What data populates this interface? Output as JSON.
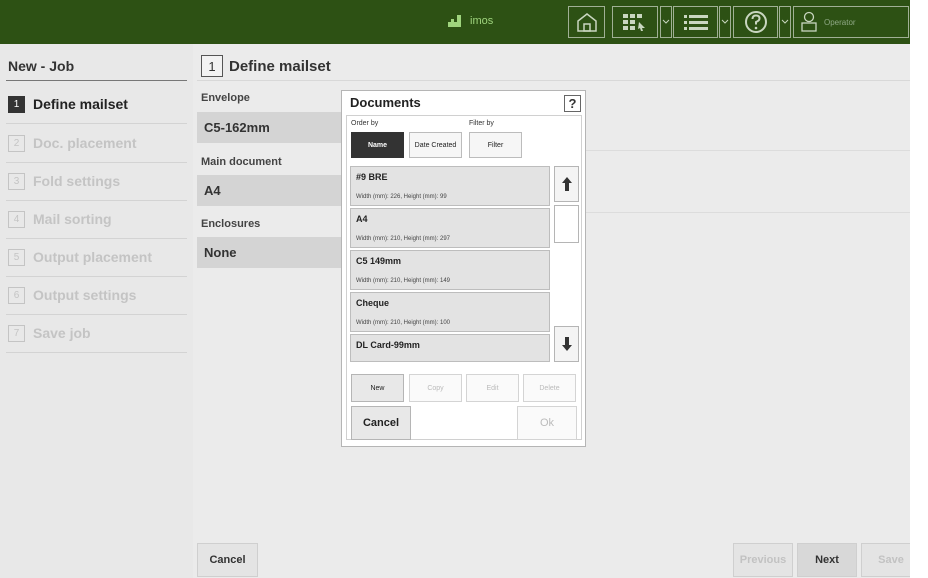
{
  "topbar": {
    "brand": "imos",
    "user": "Operator",
    "icons": [
      "home-icon",
      "grid-icon",
      "list-icon",
      "help-icon",
      "user-icon"
    ]
  },
  "sidebar": {
    "title": "New - Job",
    "steps": [
      {
        "num": "1",
        "label": "Define mailset"
      },
      {
        "num": "2",
        "label": "Doc. placement"
      },
      {
        "num": "3",
        "label": "Fold settings"
      },
      {
        "num": "4",
        "label": "Mail sorting"
      },
      {
        "num": "5",
        "label": "Output placement"
      },
      {
        "num": "6",
        "label": "Output settings"
      },
      {
        "num": "7",
        "label": "Save job"
      }
    ]
  },
  "content": {
    "step_num": "1",
    "title": "Define mailset",
    "envelope_label": "Envelope",
    "envelope_value": "C5-162mm",
    "main_doc_label": "Main document",
    "main_doc_value": "A4",
    "enclosures_label": "Enclosures",
    "enclosures_value": "None"
  },
  "bottom": {
    "cancel": "Cancel",
    "previous": "Previous",
    "next": "Next",
    "save": "Save"
  },
  "dialog": {
    "title": "Documents",
    "help": "?",
    "order_by": "Order by",
    "filter_by": "Filter by",
    "sort_name": "Name",
    "sort_date": "Date Created",
    "filter": "Filter",
    "documents": [
      {
        "name": "#9 BRE",
        "dims": "Width (mm): 226, Height (mm): 99"
      },
      {
        "name": "A4",
        "dims": "Width (mm): 210, Height (mm): 297"
      },
      {
        "name": "C5 149mm",
        "dims": "Width (mm): 210, Height (mm): 149"
      },
      {
        "name": "Cheque",
        "dims": "Width (mm): 210, Height (mm): 100"
      },
      {
        "name": "DL Card-99mm",
        "dims": ""
      }
    ],
    "new": "New",
    "copy": "Copy",
    "edit": "Edit",
    "delete": "Delete",
    "cancel": "Cancel",
    "ok": "Ok"
  }
}
